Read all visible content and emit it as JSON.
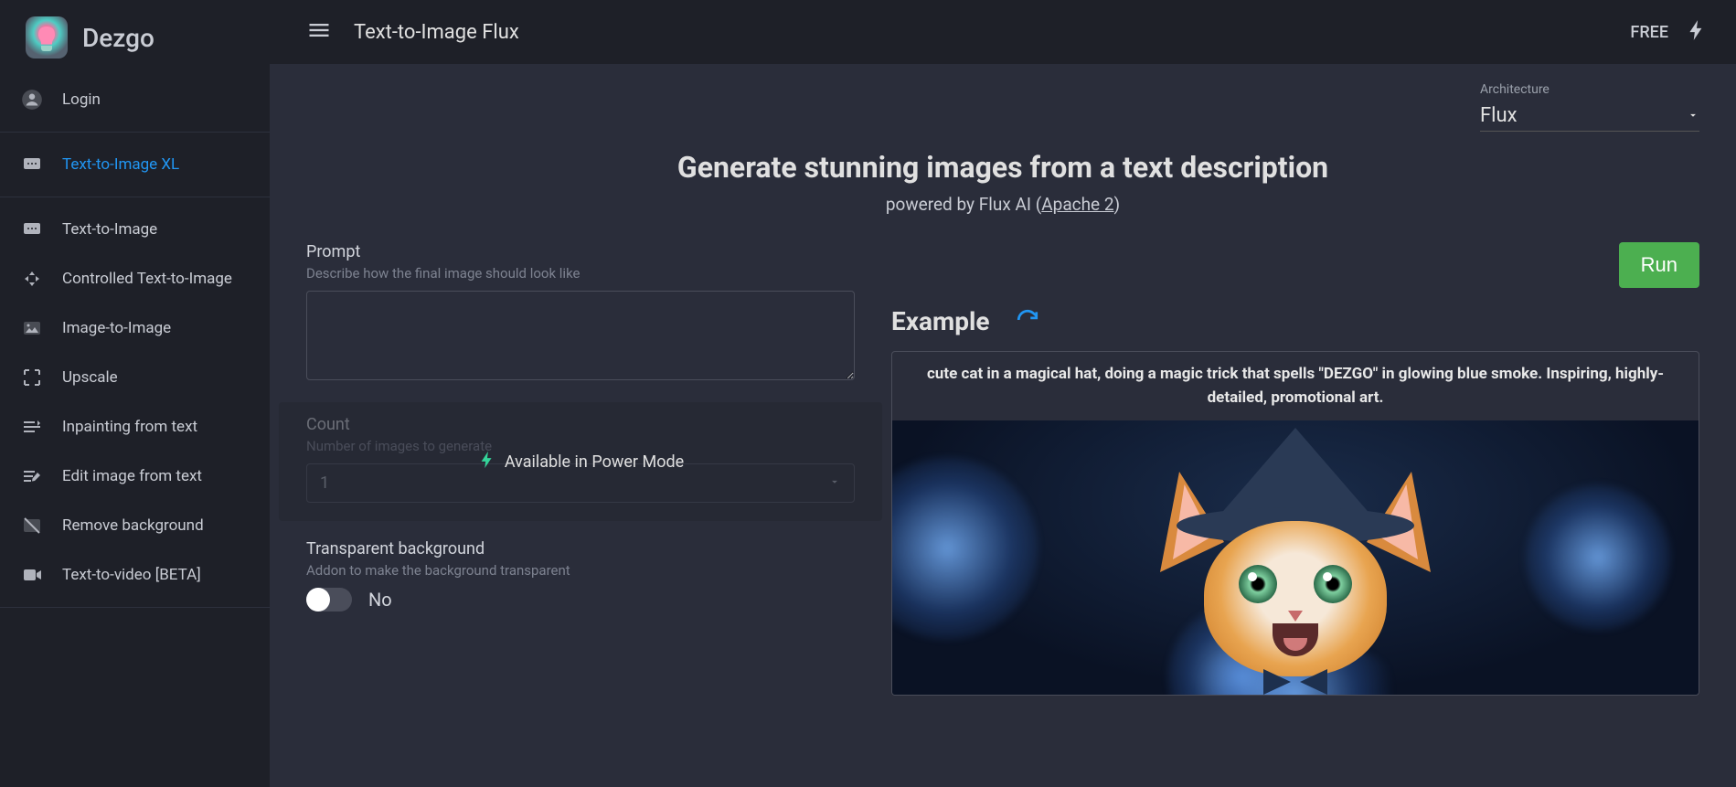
{
  "brand": {
    "name": "Dezgo"
  },
  "sidebar": {
    "login": "Login",
    "items": [
      {
        "label": "Text-to-Image XL",
        "icon": "message-icon",
        "active": true
      },
      {
        "label": "Text-to-Image",
        "icon": "message-icon"
      },
      {
        "label": "Controlled Text-to-Image",
        "icon": "controlled-icon"
      },
      {
        "label": "Image-to-Image",
        "icon": "picture-icon"
      },
      {
        "label": "Upscale",
        "icon": "upscale-icon"
      },
      {
        "label": "Inpainting from text",
        "icon": "inpaint-icon"
      },
      {
        "label": "Edit image from text",
        "icon": "edit-text-icon"
      },
      {
        "label": "Remove background",
        "icon": "remove-bg-icon"
      },
      {
        "label": "Text-to-video [BETA]",
        "icon": "video-icon"
      }
    ]
  },
  "topbar": {
    "title": "Text-to-Image Flux",
    "free": "FREE"
  },
  "architecture": {
    "label": "Architecture",
    "value": "Flux"
  },
  "hero": {
    "title": "Generate stunning images from a text description",
    "subtitle_prefix": "powered by Flux AI (",
    "license": "Apache 2",
    "subtitle_suffix": ")"
  },
  "form": {
    "prompt": {
      "label": "Prompt",
      "hint": "Describe how the final image should look like",
      "value": ""
    },
    "count": {
      "label": "Count",
      "hint": "Number of images to generate",
      "value": "1",
      "power_text": "Available in Power Mode"
    },
    "transparent": {
      "label": "Transparent background",
      "hint": "Addon to make the background transparent",
      "value_label": "No",
      "value": false
    }
  },
  "run": {
    "label": "Run"
  },
  "example": {
    "title": "Example",
    "prompt": "cute cat in a magical hat, doing a magic trick that spells \"DEZGO\" in glowing blue smoke. Inspiring, highly-detailed, promotional art."
  },
  "colors": {
    "accent": "#2196f3",
    "run": "#4caf50",
    "power": "#34d399"
  }
}
